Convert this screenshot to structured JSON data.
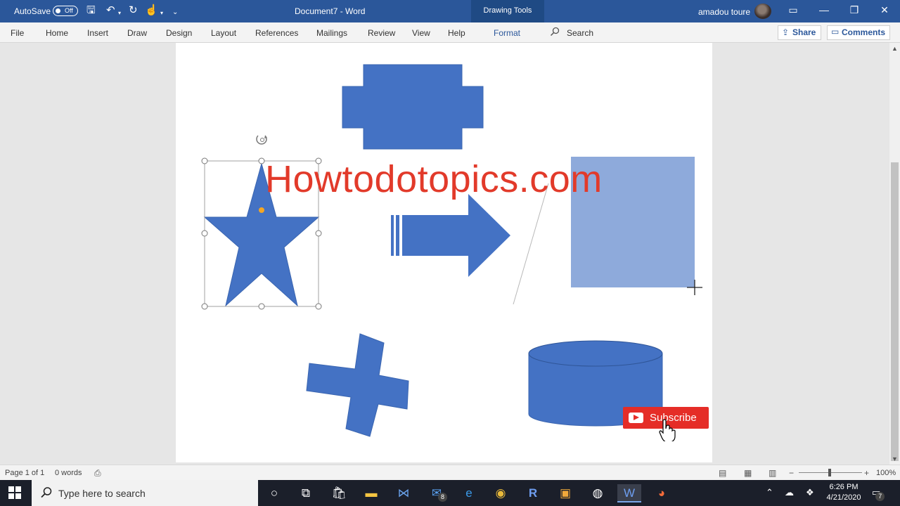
{
  "titlebar": {
    "autosave_label": "AutoSave",
    "autosave_state": "Off",
    "document_title": "Document7 - Word",
    "context_tab": "Drawing Tools",
    "user_name": "amadou toure",
    "minimize": "—",
    "restore": "❐",
    "close": "✕"
  },
  "ribbon": {
    "tabs": [
      "File",
      "Home",
      "Insert",
      "Draw",
      "Design",
      "Layout",
      "References",
      "Mailings",
      "Review",
      "View",
      "Help",
      "Format"
    ],
    "search_label": "Search",
    "share_label": "Share",
    "comments_label": "Comments"
  },
  "document": {
    "watermark_text": "Howtodotopics.com",
    "shapes": [
      "plaque",
      "star",
      "arrow",
      "rectangle",
      "cross",
      "cylinder"
    ],
    "colors": {
      "shape_fill": "#4472c4",
      "rect_fill": "#8eaadb",
      "watermark": "#e23a2a"
    }
  },
  "overlay": {
    "subscribe_label": "Subscribe"
  },
  "statusbar": {
    "page_info": "Page 1 of 1",
    "word_count": "0 words",
    "zoom": "100%"
  },
  "taskbar": {
    "search_placeholder": "Type here to search",
    "mail_badge": "8",
    "time": "6:26 PM",
    "date": "4/21/2020",
    "notification_count": "7"
  }
}
